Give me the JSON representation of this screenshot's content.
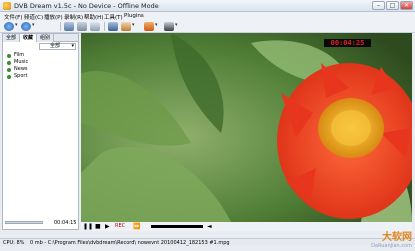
{
  "window": {
    "title": "DVB Dream v1.5c - No Device - Offline Mode",
    "minimize_glyph": "–",
    "maximize_glyph": "□",
    "close_glyph": "✕"
  },
  "menu": [
    "文件(F)",
    "频道(C)",
    "播放(P)",
    "录制(R)",
    "帮助(H)",
    "工具(T)",
    "Plugins"
  ],
  "toolbar": {
    "dropdown_glyph": "▾",
    "icons": [
      "back-icon",
      "forward-icon",
      "record-list-icon",
      "settings-icon",
      "epg-icon",
      "scan-icon",
      "audio-icon",
      "display-icon",
      "fullscreen-icon"
    ]
  },
  "sidebar": {
    "tabs": [
      "全部",
      "收藏",
      "组别"
    ],
    "active_tab": 1,
    "filter_value": "全部",
    "filter_arrow": "▾",
    "channels": [
      "Film",
      "Music",
      "News",
      "Sport"
    ]
  },
  "playback": {
    "timestamp": "00:04:25",
    "elapsed": "00:04:15",
    "pause_glyph": "❚❚",
    "stop_glyph": "■",
    "play_glyph": "▶",
    "rec_label": "REC",
    "ff_glyph": "⏩",
    "volume_glyph": "◄"
  },
  "status": {
    "cpu": "CPU: 8%",
    "path": "0 mb - C:\\Program Files\\dvbdream\\Record\\ nowevnt 20100412_182153 #1.mpg"
  },
  "watermark": {
    "logo": "大软网",
    "url": "DaRuanJian.com"
  },
  "colors": {
    "timestamp_text": "#e32020",
    "flower_petal": "#e8361e",
    "flower_center": "#f2b21c",
    "leaf": "#4f7d35"
  }
}
